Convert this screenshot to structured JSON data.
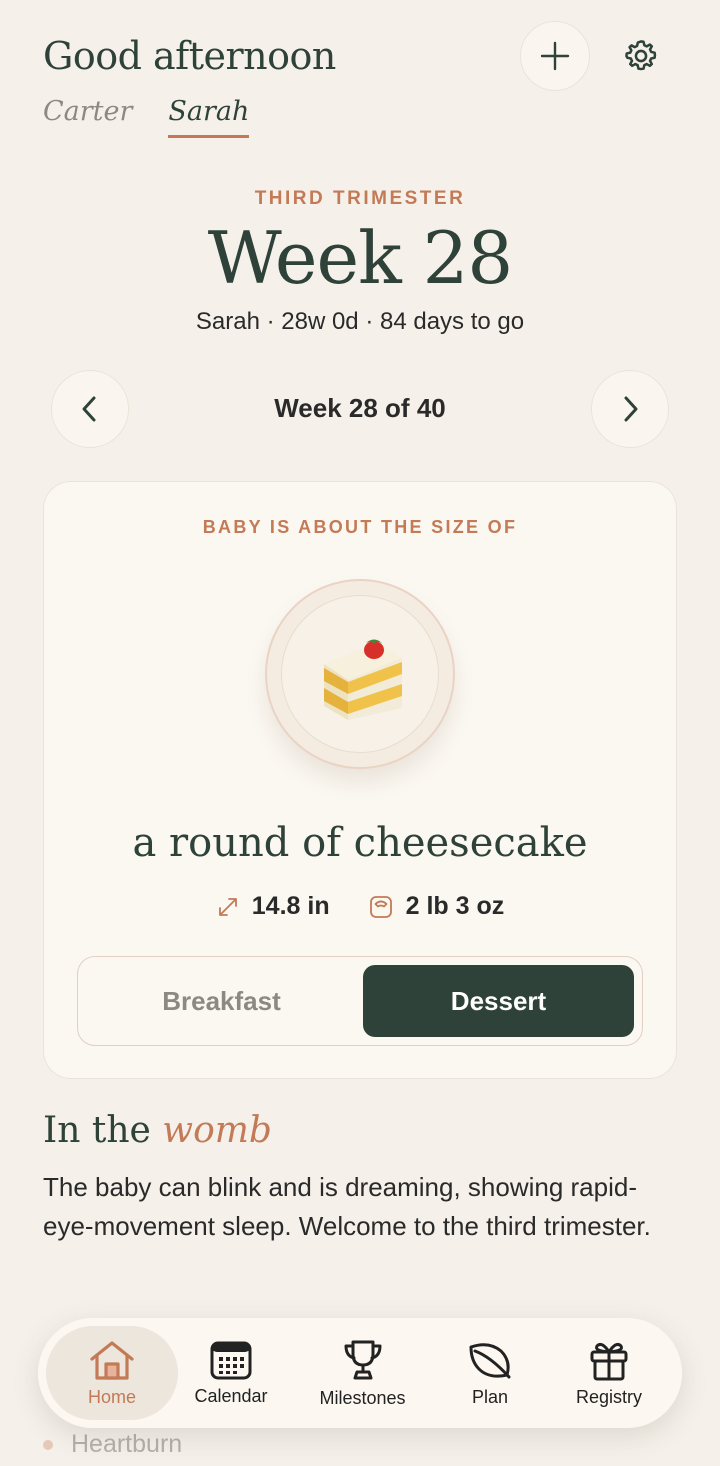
{
  "header": {
    "greeting": "Good afternoon",
    "profiles": [
      {
        "name": "Carter",
        "active": false
      },
      {
        "name": "Sarah",
        "active": true
      }
    ],
    "add_icon": "plus-icon",
    "settings_icon": "gear-icon"
  },
  "week": {
    "trimester": "THIRD TRIMESTER",
    "title": "Week 28",
    "subtitle": "Sarah · 28w 0d · 84 days to go",
    "navigator_label": "Week 28 of 40"
  },
  "size_card": {
    "label": "BABY IS ABOUT THE SIZE OF",
    "item_icon": "cheesecake-slice-icon",
    "item_name": "a round of cheesecake",
    "length": "14.8 in",
    "weight": "2 lb 3 oz",
    "toggle": {
      "options": [
        "Breakfast",
        "Dessert"
      ],
      "selected": "Dessert"
    }
  },
  "womb": {
    "title_plain": "In the ",
    "title_accent": "womb",
    "body": "The baby can blink and is dreaming, showing rapid-eye-movement sleep. Welcome to the third trimester."
  },
  "symptoms": {
    "first_item": "Heartburn"
  },
  "tabbar": {
    "tabs": [
      {
        "label": "Home",
        "icon": "home-icon",
        "active": true
      },
      {
        "label": "Calendar",
        "icon": "calendar-icon",
        "active": false
      },
      {
        "label": "Milestones",
        "icon": "trophy-icon",
        "active": false
      },
      {
        "label": "Plan",
        "icon": "leaf-icon",
        "active": false
      },
      {
        "label": "Registry",
        "icon": "gift-icon",
        "active": false
      }
    ]
  },
  "colors": {
    "background": "#f5f1ea",
    "primary_green": "#2e4239",
    "accent_terracotta": "#c37a56",
    "card": "#fbf8f2"
  }
}
